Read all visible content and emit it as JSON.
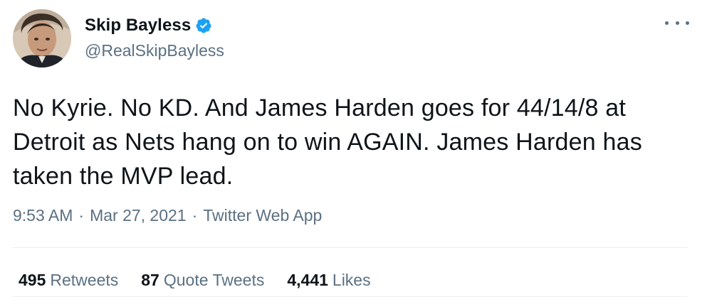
{
  "author": {
    "name": "Skip Bayless",
    "handle": "@RealSkipBayless",
    "avatar_icon": "profile-photo",
    "verified_icon": "verified-badge-icon"
  },
  "tweet": {
    "text": "No Kyrie. No KD. And James Harden goes for 44/14/8 at Detroit as Nets hang on to win AGAIN. James Harden has taken the MVP lead."
  },
  "meta": {
    "time": "9:53 AM",
    "separator": "·",
    "date": "Mar 27, 2021",
    "source": "Twitter Web App"
  },
  "stats": {
    "retweets_count": "495",
    "retweets_label": "Retweets",
    "quote_count": "87",
    "quote_label": "Quote Tweets",
    "likes_count": "4,441",
    "likes_label": "Likes"
  },
  "colors": {
    "text_primary": "#0f1419",
    "text_secondary": "#5b7083",
    "verified_blue": "#1da1f2",
    "divider": "#ebeef0"
  }
}
